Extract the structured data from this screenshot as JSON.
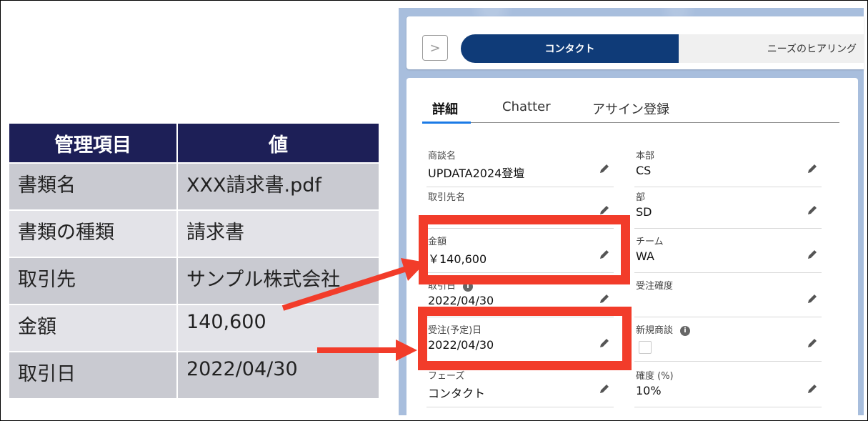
{
  "table": {
    "headers": [
      "管理項目",
      "値"
    ],
    "rows": [
      {
        "key": "書類名",
        "value": "XXX請求書.pdf"
      },
      {
        "key": "書類の種類",
        "value": "請求書"
      },
      {
        "key": "取引先",
        "value": "サンプル株式会社"
      },
      {
        "key": "金額",
        "value": "140,600"
      },
      {
        "key": "取引日",
        "value": "2022/04/30"
      }
    ],
    "colors": {
      "header_bg": "#1d1f57",
      "row_dark": "#c9cad1",
      "row_light": "#e3e3e8"
    }
  },
  "path": {
    "toggle_icon": "chevron-right-icon",
    "toggle_glyph": ">",
    "stages": [
      {
        "label": "コンタクト",
        "active": true
      },
      {
        "label": "ニーズのヒアリング",
        "active": false
      }
    ],
    "active_color": "#0f3b78"
  },
  "tabs": [
    {
      "label": "詳細",
      "active": true
    },
    {
      "label": "Chatter",
      "active": false
    },
    {
      "label": "アサイン登録",
      "active": false
    }
  ],
  "fields_left": [
    {
      "label": "商談名",
      "value": "UPDATA2024登壇"
    },
    {
      "label": "取引先名",
      "value": ""
    },
    {
      "label": "金額",
      "value": "￥140,600",
      "highlighted": true
    },
    {
      "label": "取引日",
      "value": "2022/04/30",
      "info": true
    },
    {
      "label": "受注(予定)日",
      "value": "2022/04/30",
      "highlighted": true
    },
    {
      "label": "フェーズ",
      "value": "コンタクト"
    }
  ],
  "fields_right": [
    {
      "label": "本部",
      "value": "CS"
    },
    {
      "label": "部",
      "value": "SD"
    },
    {
      "label": "チーム",
      "value": "WA"
    },
    {
      "label": "受注確度",
      "value": ""
    },
    {
      "label": "新規商談",
      "value": "",
      "checkbox": true,
      "checked": false,
      "info": true
    },
    {
      "label": "確度 (%)",
      "value": "10%"
    }
  ],
  "annotation_color": "#f23c2a",
  "info_glyph": "i"
}
